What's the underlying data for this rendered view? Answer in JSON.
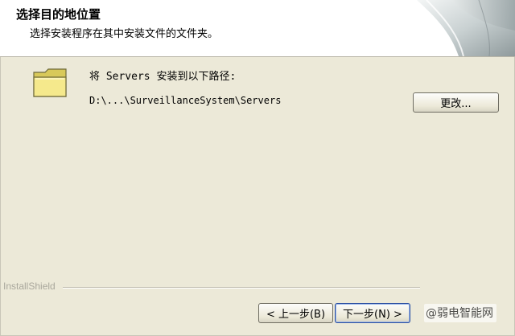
{
  "header": {
    "title": "选择目的地位置",
    "subtitle": "选择安装程序在其中安装文件的文件夹。"
  },
  "content": {
    "install_label": "将 Servers 安装到以下路径:",
    "install_path": "D:\\...\\SurveillanceSystem\\Servers",
    "change_button": "更改..."
  },
  "footer": {
    "brand": "InstallShield",
    "back_button": "< 上一步(B)",
    "next_button": "下一步(N) >",
    "watermark": "@弱电智能网"
  },
  "colors": {
    "background": "#ece9d8",
    "header_bg": "#ffffff",
    "folder_fill": "#f5e98c"
  },
  "icons": {
    "folder": "folder-icon",
    "header_graphic": "page-curl-graphic"
  }
}
